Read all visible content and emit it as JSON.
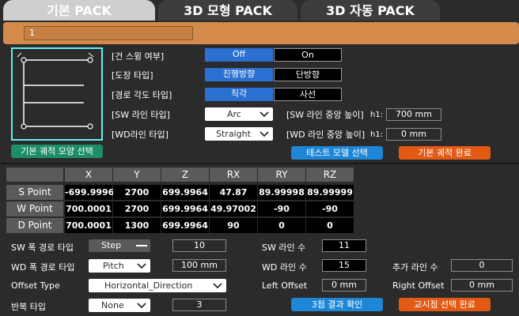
{
  "tabs": [
    {
      "label": "기본 PACK"
    },
    {
      "label": "3D 모형 PACK"
    },
    {
      "label": "3D 자동 PACK"
    }
  ],
  "name_field": {
    "value": "1"
  },
  "options": {
    "gun_swing": {
      "label": "[건 스윙 여부]",
      "opt1": "Off",
      "opt2": "On"
    },
    "paint_type": {
      "label": "[도장 타입]",
      "opt1": "진행방향",
      "opt2": "단방향"
    },
    "path_angle": {
      "label": "[경로 각도 타입]",
      "opt1": "직각",
      "opt2": "사선"
    },
    "sw_line_type": {
      "label": "[SW 라인 타입]",
      "value": "Arc"
    },
    "wd_line_type": {
      "label": "[WD라인 타입]",
      "value": "Straight"
    },
    "sw_height": {
      "label": "[SW  라인 중앙 높이]",
      "prefix": "h1:",
      "value": "700 mm"
    },
    "wd_height": {
      "label": "[WD  라인 중앙 높이]",
      "prefix": "h1:",
      "value": "0 mm"
    }
  },
  "buttons": {
    "shape_select": "기본 궤적 모양 선택",
    "test_model": "테스트 모델 선택",
    "basic_done": "기본 궤적 완료",
    "three_point": "3점 결과 확인",
    "teach_done": "교시점 선택 완료"
  },
  "table": {
    "headers": [
      "X",
      "Y",
      "Z",
      "RX",
      "RY",
      "RZ"
    ],
    "rows": [
      {
        "label": "S Point",
        "values": [
          "-699.9996",
          "2700",
          "699.9964",
          "47.87",
          "89.99998",
          "89.99999"
        ]
      },
      {
        "label": "W Point",
        "values": [
          "700.0001",
          "2700",
          "699.9964",
          "49.97002",
          "-90",
          "-90"
        ]
      },
      {
        "label": "D Point",
        "values": [
          "700.0001",
          "1300",
          "699.9964",
          "90",
          "0",
          "0"
        ]
      }
    ]
  },
  "bottom": {
    "sw_path_type": {
      "label": "SW 폭 경로 타입",
      "value": "Step",
      "field": "10"
    },
    "wd_path_type": {
      "label": "WD 폭 경로 타입",
      "value": "Pitch",
      "field": "100 mm"
    },
    "offset_type": {
      "label": "Offset Type",
      "value": "Horizontal_Direction"
    },
    "repeat_type": {
      "label": "반복 타입",
      "value": "None",
      "field": "3"
    },
    "sw_line_count": {
      "label": "SW 라인 수",
      "value": "11"
    },
    "wd_line_count": {
      "label": "WD 라인 수",
      "value": "15"
    },
    "extra_line_count": {
      "label": "추가 라인 수",
      "value": "0"
    },
    "left_offset": {
      "label": "Left Offset",
      "value": "0 mm"
    },
    "right_offset": {
      "label": "Right Offset",
      "value": "0 mm"
    }
  },
  "colors": {
    "accent_blue": "#2b6fd0",
    "orange": "#e25a14",
    "green": "#1e8e6a",
    "panel_orange": "#d48a4a",
    "cyan": "#5ff0f0"
  }
}
